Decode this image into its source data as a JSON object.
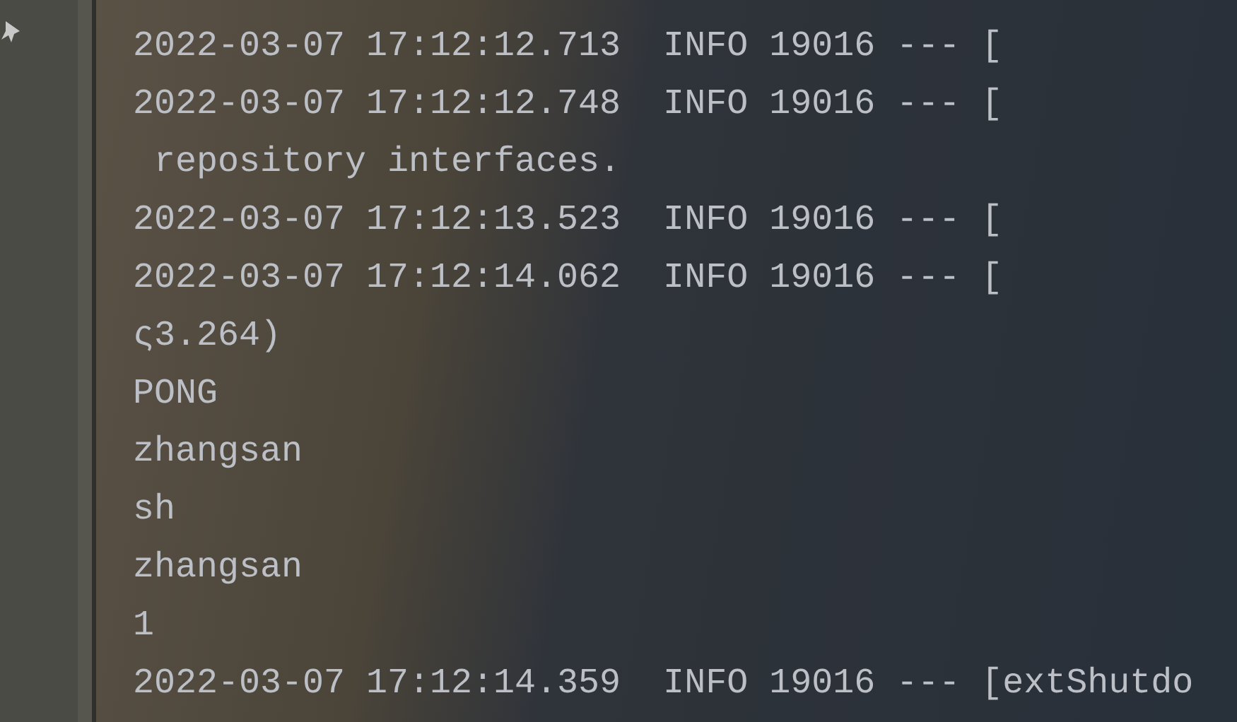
{
  "console": {
    "lines": [
      {
        "text": "2022-03-07 17:12:12.713  INFO 19016 --- ["
      },
      {
        "text": "2022-03-07 17:12:12.748  INFO 19016 --- ["
      },
      {
        "text": " repository interfaces."
      },
      {
        "text": "2022-03-07 17:12:13.523  INFO 19016 --- ["
      },
      {
        "text": "2022-03-07 17:12:14.062  INFO 19016 --- ["
      },
      {
        "text": "ς3.264)"
      },
      {
        "text": "PONG"
      },
      {
        "text": "zhangsan"
      },
      {
        "text": "sh"
      },
      {
        "text": "zhangsan"
      },
      {
        "text": "1"
      },
      {
        "text": "2022-03-07 17:12:14.359  INFO 19016 --- [extShutdo"
      }
    ]
  }
}
